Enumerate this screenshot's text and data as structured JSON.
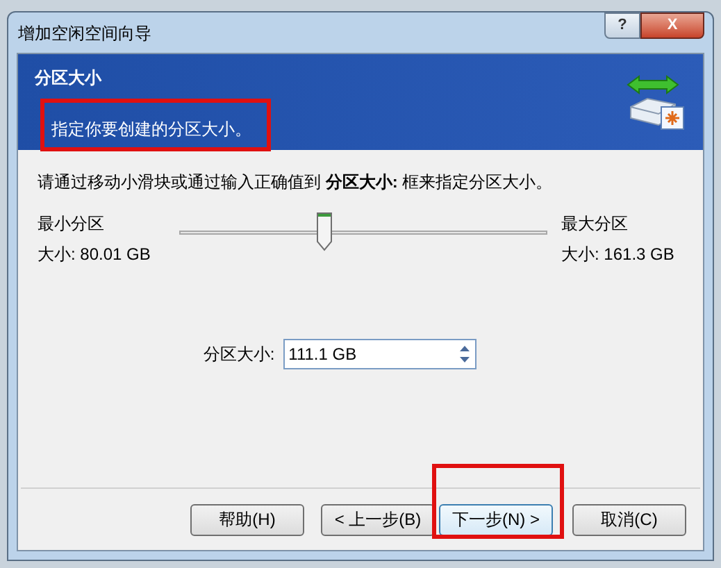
{
  "window": {
    "title": "增加空闲空间向导",
    "buttons": [
      {
        "kind": "help",
        "label": "?"
      },
      {
        "kind": "close",
        "label": "X"
      }
    ]
  },
  "header": {
    "title": "分区大小",
    "subtitle": "指定你要创建的分区大小。",
    "subtitle_highlighted": true
  },
  "instruction": "请通过移动小滑块或通过输入正确值到 **分区大小:** 框来指定分区大小。",
  "slider": {
    "min_label": "最小分区",
    "min_size": "大小: 80.01 GB",
    "max_label": "最大分区",
    "max_size": "大小: 161.3 GB",
    "level": 0.39
  },
  "size_field": {
    "label": "分区大小:",
    "value": "111.1 GB"
  },
  "buttons": [
    {
      "label": "帮助(H)",
      "default": false,
      "highlighted": false
    },
    {
      "label": "< 上一步(B)",
      "default": false,
      "highlighted": false
    },
    {
      "label": "下一步(N) >",
      "default": true,
      "highlighted": true
    },
    {
      "label": "取消(C)",
      "default": false,
      "highlighted": false
    }
  ]
}
